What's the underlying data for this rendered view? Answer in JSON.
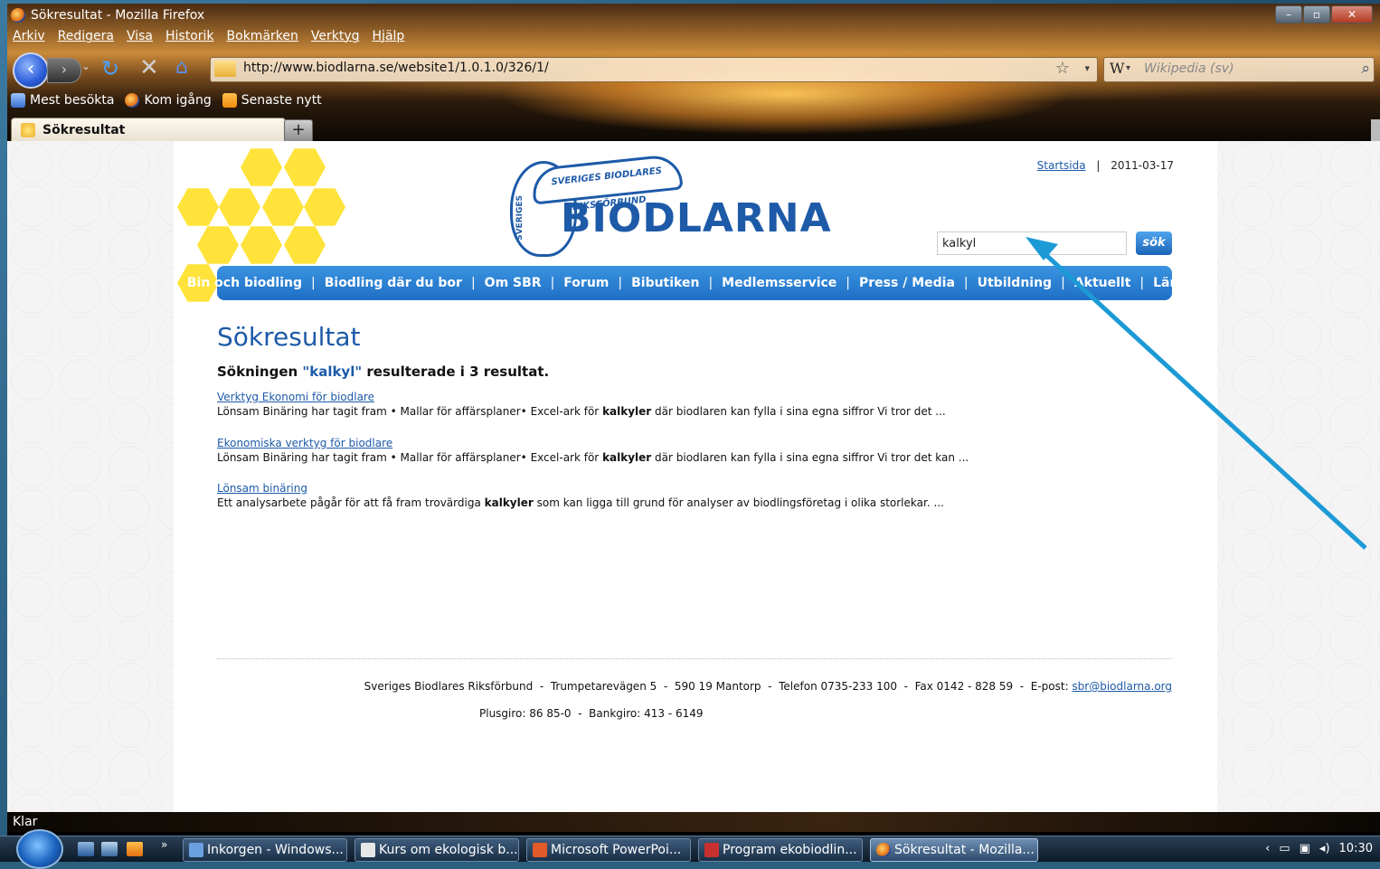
{
  "window": {
    "title": "Sökresultat - Mozilla Firefox",
    "menu": [
      "Arkiv",
      "Redigera",
      "Visa",
      "Historik",
      "Bokmärken",
      "Verktyg",
      "Hjälp"
    ],
    "url": "http://www.biodlarna.se/website1/1.0.1.0/326/1/",
    "search_placeholder": "Wikipedia (sv)",
    "bookmarks": [
      "Mest besökta",
      "Kom igång",
      "Senaste nytt"
    ],
    "tab_label": "Sökresultat",
    "new_tab": "+",
    "status": "Klar"
  },
  "site": {
    "logo_arc": "SVERIGES BIODLARES RIKSFÖRBUND",
    "logo_vertical": "SVERIGES",
    "logo_text": "BIODLARNA",
    "startsida": "Startsida",
    "separator": "|",
    "date": "2011-03-17",
    "search_value": "kalkyl",
    "search_button": "sök",
    "nav": [
      "Bin och biodling",
      "Biodling där du bor",
      "Om SBR",
      "Forum",
      "Bibutiken",
      "Medlemsservice",
      "Press / Media",
      "Utbildning",
      "Aktuellt",
      "Länkar"
    ]
  },
  "results": {
    "heading": "Sökresultat",
    "summary_prefix": "Sökningen ",
    "summary_query": "\"kalkyl\"",
    "summary_suffix": " resulterade i 3 resultat.",
    "items": [
      {
        "title": "Verktyg Ekonomi för biodlare",
        "pre": "Lönsam Binäring har tagit fram • Mallar för affärsplaner• Excel-ark för ",
        "hit": "kalkyler",
        "post": " där biodlaren kan fylla i sina egna siffror Vi tror det ..."
      },
      {
        "title": "Ekonomiska verktyg för biodlare",
        "pre": "Lönsam Binäring har tagit fram • Mallar för affärsplaner• Excel-ark för ",
        "hit": "kalkyler",
        "post": " där biodlaren kan fylla i sina egna siffror Vi tror det kan ..."
      },
      {
        "title": "Lönsam binäring",
        "pre": "Ett analysarbete pågår för att få fram trovärdiga ",
        "hit": "kalkyler",
        "post": " som kan ligga till grund för analyser av biodlingsföretag i olika storlekar. ..."
      }
    ]
  },
  "footer": {
    "line1_prefix": "Sveriges Biodlares Riksförbund  -  Trumpetarevägen 5  -  590 19 Mantorp  -  Telefon 0735-233 100  -  Fax 0142 - 828 59  -  E-post: ",
    "email": "sbr@biodlarna.org",
    "line2": "Plusgiro: 86 85-0  -  Bankgiro: 413 - 6149"
  },
  "taskbar": {
    "buttons": [
      "Inkorgen - Windows...",
      "Kurs om ekologisk b...",
      "Microsoft PowerPoi...",
      "Program ekobiodlin...",
      "Sökresultat - Mozilla..."
    ],
    "time": "10:30"
  },
  "colors": {
    "brand_blue": "#1d5aa8",
    "nav_blue": "#2a80d6",
    "honey_yellow": "#ffe33b",
    "arrow": "#1c9ad6"
  }
}
